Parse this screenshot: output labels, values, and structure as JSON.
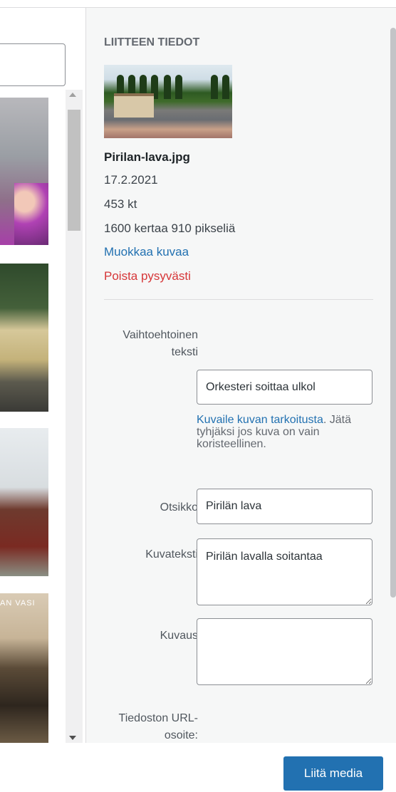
{
  "sidebar": {
    "heading": "LIITTEEN TIEDOT",
    "filename": "Pirilan-lava.jpg",
    "date": "17.2.2021",
    "size": "453 kt",
    "dimensions": "1600 kertaa 910 pikseliä",
    "edit_link": "Muokkaa kuvaa",
    "delete_link": "Poista pysyvästi",
    "fields": {
      "alt_label": "Vaihtoehtoinen teksti",
      "alt_value": "Orkesteri soittaa ulkol",
      "help_link": "Kuvaile kuvan tarkoitusta",
      "help_rest": ". Jätä tyhjäksi jos kuva on vain koristeellinen.",
      "title_label": "Otsikko",
      "title_value": "Pirilän lava",
      "caption_label": "Kuvateksti",
      "caption_value": "Pirilän lavalla soitantaa",
      "description_label": "Kuvaus",
      "description_value": "",
      "url_label": "Tiedoston URL-osoite:"
    }
  },
  "library": {
    "thumb_overlay_text": "AN VASI"
  },
  "footer": {
    "insert_button": "Liitä media"
  },
  "colors": {
    "primary": "#2271b1",
    "danger": "#d63638",
    "sidebar_bg": "#f6f7f7"
  }
}
